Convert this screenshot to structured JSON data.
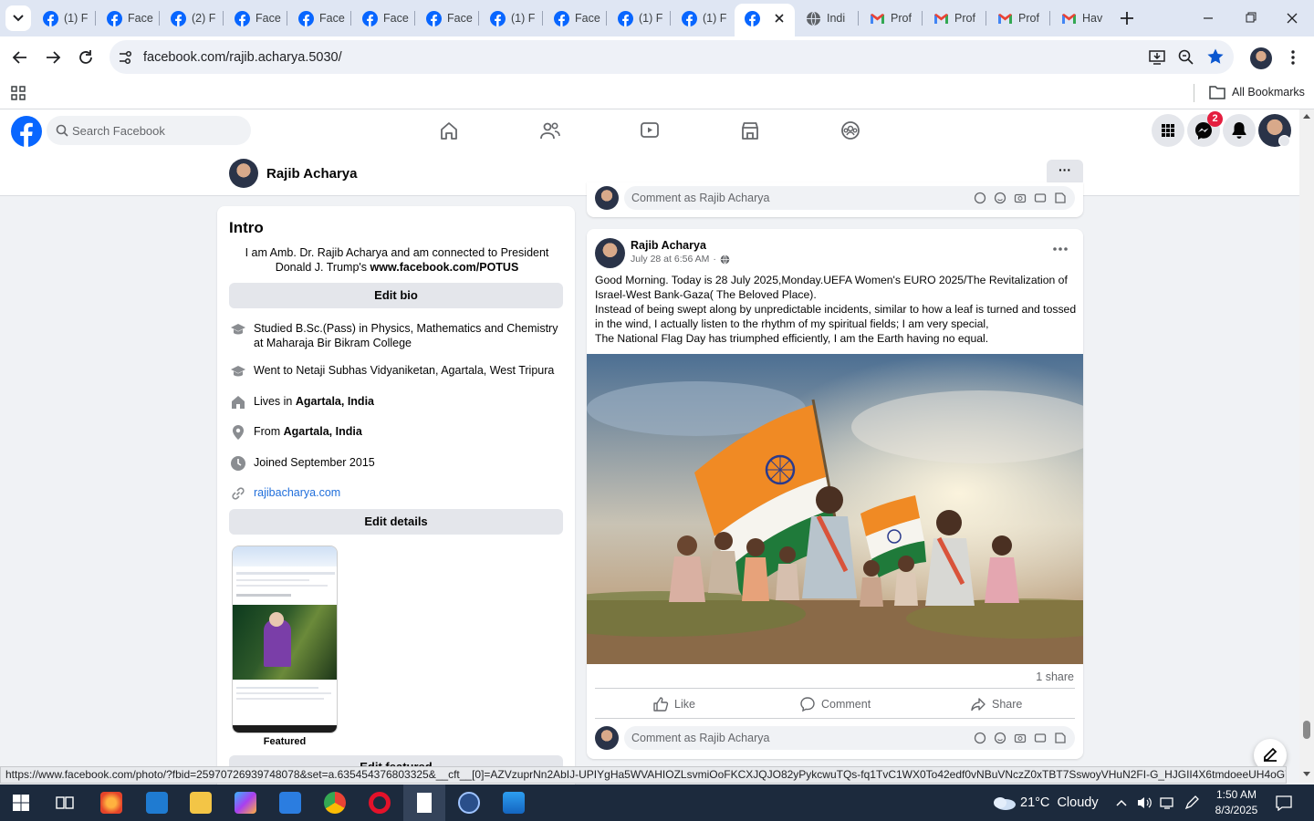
{
  "browser": {
    "tabs": [
      {
        "label": "(1) F",
        "icon": "facebook-icon"
      },
      {
        "label": "Face",
        "icon": "facebook-icon"
      },
      {
        "label": "(2) F",
        "icon": "facebook-icon"
      },
      {
        "label": "Face",
        "icon": "facebook-icon"
      },
      {
        "label": "Face",
        "icon": "facebook-icon"
      },
      {
        "label": "Face",
        "icon": "facebook-icon"
      },
      {
        "label": "Face",
        "icon": "facebook-icon"
      },
      {
        "label": "(1) F",
        "icon": "facebook-icon"
      },
      {
        "label": "Face",
        "icon": "facebook-icon"
      },
      {
        "label": "(1) F",
        "icon": "facebook-icon"
      },
      {
        "label": "(1) F",
        "icon": "facebook-icon"
      },
      {
        "label": "",
        "icon": "facebook-icon",
        "active": true
      },
      {
        "label": "Indi",
        "icon": "globe-icon"
      },
      {
        "label": "Prof",
        "icon": "gmail-icon"
      },
      {
        "label": "Prof",
        "icon": "gmail-icon"
      },
      {
        "label": "Prof",
        "icon": "gmail-icon"
      },
      {
        "label": "Hav",
        "icon": "gmail-icon"
      }
    ],
    "url": "facebook.com/rajib.acharya.5030/",
    "all_bookmarks": "All Bookmarks"
  },
  "facebook": {
    "search_placeholder": "Search Facebook",
    "messenger_badge": "2",
    "profile_name": "Rajib Acharya",
    "more_label": "···"
  },
  "intro": {
    "title": "Intro",
    "bio_text": "I am Amb. Dr. Rajib Acharya and am connected to President Donald J. Trump's",
    "bio_link": "www.facebook.com/POTUS",
    "edit_bio": "Edit bio",
    "details": [
      {
        "icon": "education-icon",
        "text": "Studied B.Sc.(Pass) in Physics, Mathematics and Chemistry at Maharaja Bir Bikram College"
      },
      {
        "icon": "education-icon",
        "text": "Went to Netaji Subhas Vidyaniketan, Agartala, West Tripura"
      },
      {
        "icon": "home-location-icon",
        "prefix": "Lives in ",
        "bold": "Agartala, India"
      },
      {
        "icon": "pin-icon",
        "prefix": "From ",
        "bold": "Agartala, India"
      },
      {
        "icon": "clock-icon",
        "text": "Joined September 2015"
      },
      {
        "icon": "link-icon",
        "link": "rajibacharya.com"
      }
    ],
    "edit_details": "Edit details",
    "featured_label": "Featured",
    "edit_featured": "Edit featured"
  },
  "prev_post": {
    "comment_placeholder": "Comment as Rajib Acharya"
  },
  "post": {
    "author": "Rajib Acharya",
    "time": "July 28 at 6:56 AM",
    "visibility_icon": "globe-icon",
    "text_lines": [
      "Good Morning. Today is 28 July 2025,Monday.UEFA Women's EURO 2025/The Revitalization of",
      "Israel-West Bank-Gaza( The Beloved Place).",
      "Instead of being swept along by unpredictable incidents, similar to how a leaf is turned and tossed",
      "in the wind, I actually listen to the rhythm of my spiritual fields; I am very special,",
      "The National Flag Day has triumphed efficiently, I am the Earth having no equal."
    ],
    "shares": "1 share",
    "like": "Like",
    "comment": "Comment",
    "share": "Share",
    "comment_placeholder": "Comment as Rajib Acharya"
  },
  "status_url": "https://www.facebook.com/photo/?fbid=25970726939748078&set=a.635454376803325&__cft__[0]=AZVzuprNn2AbIJ-UPIYgHa5WVAHIOZLsvmiOoFKCXJQJO82yPykcwuTQs-fq1TvC1WX0To42edf0vNBuVNczZ0xTBT7SswoyVHuN2FI-G_HJGII4X6tmdoeeUH4oG7uoeQ...",
  "taskbar": {
    "weather": "21°C  Cloudy",
    "time": "1:50 AM",
    "date": "8/3/2025"
  },
  "colors": {
    "fb_blue": "#0866ff",
    "link_blue": "#216fdb",
    "badge_red": "#e41e3f",
    "taskbar": "#1c2a3d"
  }
}
